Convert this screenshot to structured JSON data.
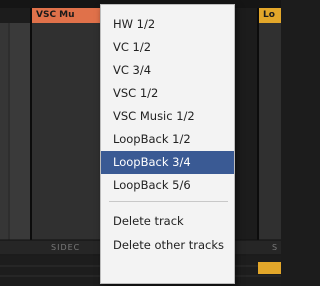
{
  "tracks": [
    {
      "header_label": "VSC Mu",
      "header_color": "#e0714a",
      "sidechain_label": "SIDEC"
    },
    {
      "header_label": "Lo",
      "header_color": "#e3a72a",
      "sidechain_label": "S"
    }
  ],
  "context_menu": {
    "items": [
      {
        "label": "HW 1/2",
        "selected": false
      },
      {
        "label": "VC 1/2",
        "selected": false
      },
      {
        "label": "VC 3/4",
        "selected": false
      },
      {
        "label": "VSC 1/2",
        "selected": false
      },
      {
        "label": "VSC Music 1/2",
        "selected": false
      },
      {
        "label": "LoopBack 1/2",
        "selected": false
      },
      {
        "label": "LoopBack 3/4",
        "selected": true
      },
      {
        "label": "LoopBack 5/6",
        "selected": false
      }
    ],
    "actions": [
      {
        "label": "Delete track"
      },
      {
        "label": "Delete other tracks"
      }
    ],
    "selected_color": "#3a5a94"
  }
}
